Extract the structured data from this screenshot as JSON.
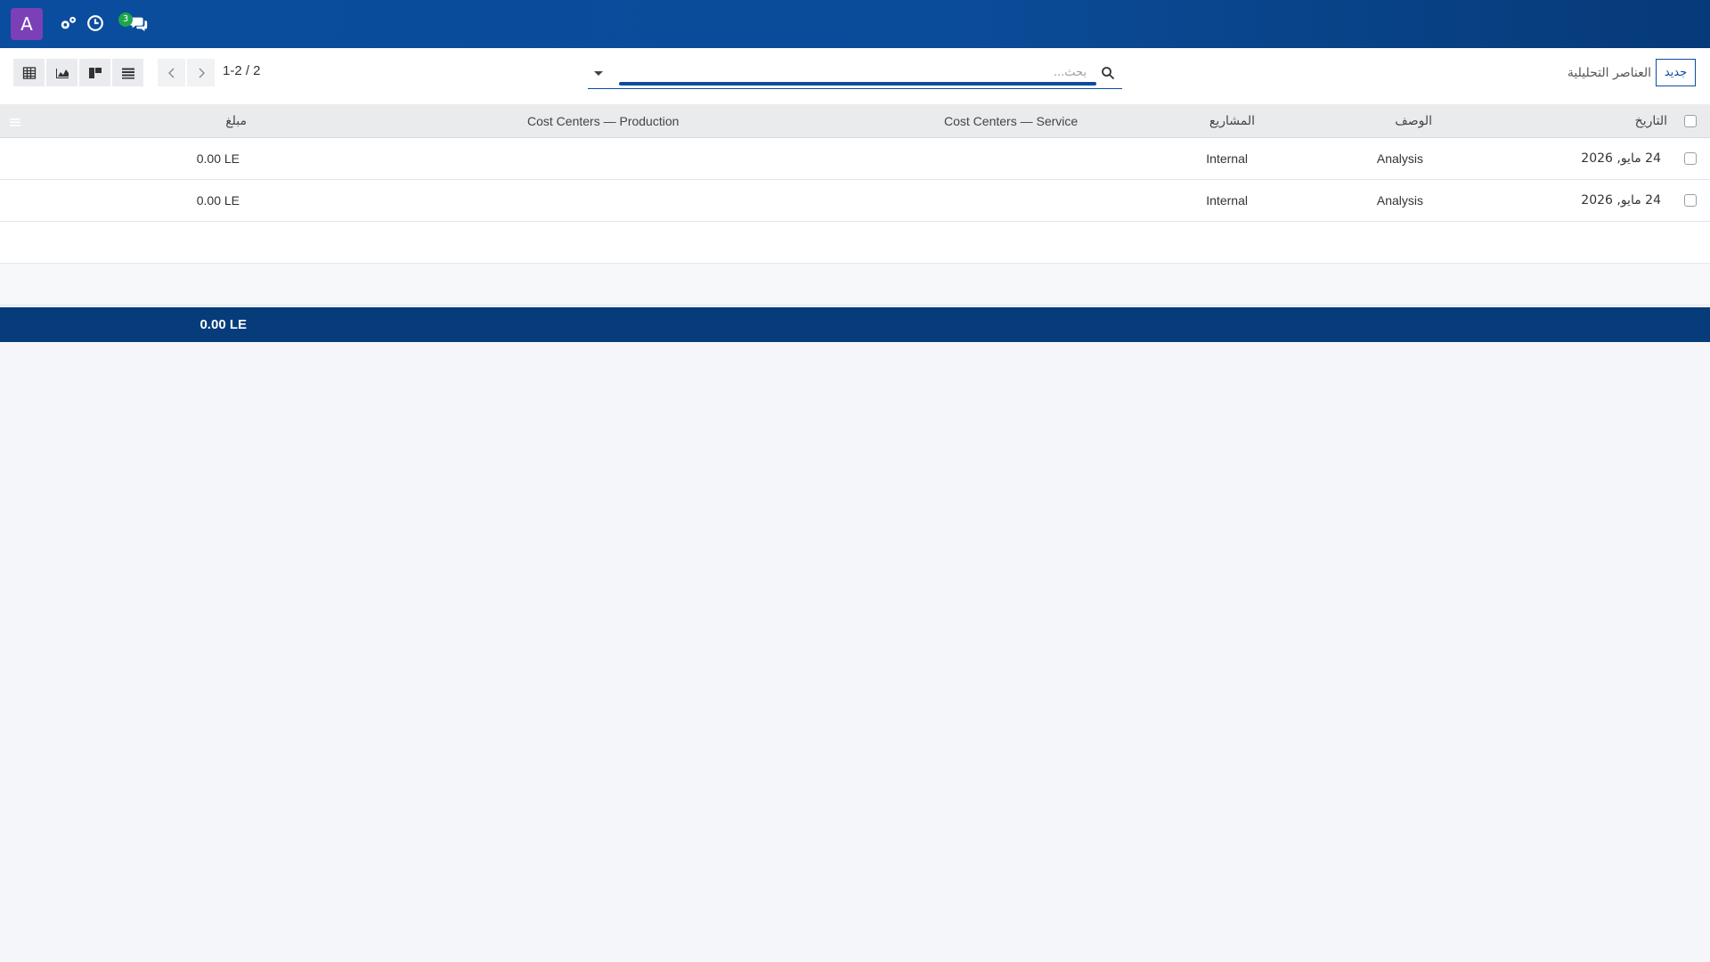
{
  "navbar": {
    "avatar_letter": "A",
    "messages_badge": "3",
    "icons": [
      "settings-icon",
      "clock-icon",
      "chat-icon"
    ]
  },
  "control_panel": {
    "new_button_label": "جديد",
    "title": "العناصر التحليلية",
    "search_placeholder": "بحث...",
    "pager": "1-2 / 2",
    "views": [
      "pivot-view",
      "graph-view",
      "kanban-view",
      "list-view"
    ]
  },
  "table": {
    "columns": {
      "date": "التاريخ",
      "description": "الوصف",
      "projects": "المشاريع",
      "cc_service": "Cost Centers — Service",
      "cc_production": "Cost Centers — Production",
      "amount": "مبلغ"
    },
    "rows": [
      {
        "date": "24 مايو, 2026",
        "description": "Analysis",
        "project": "Internal",
        "cc_service": "",
        "cc_production": "",
        "amount": "0.00 LE"
      },
      {
        "date": "24 مايو, 2026",
        "description": "Analysis",
        "project": "Internal",
        "cc_service": "",
        "cc_production": "",
        "amount": "0.00 LE"
      }
    ],
    "total_amount": "0.00 LE"
  },
  "colors": {
    "navbar": "#0a4d9e",
    "footer": "#063c7a",
    "avatar": "#7b3fb8",
    "badge": "#1ea54d"
  }
}
